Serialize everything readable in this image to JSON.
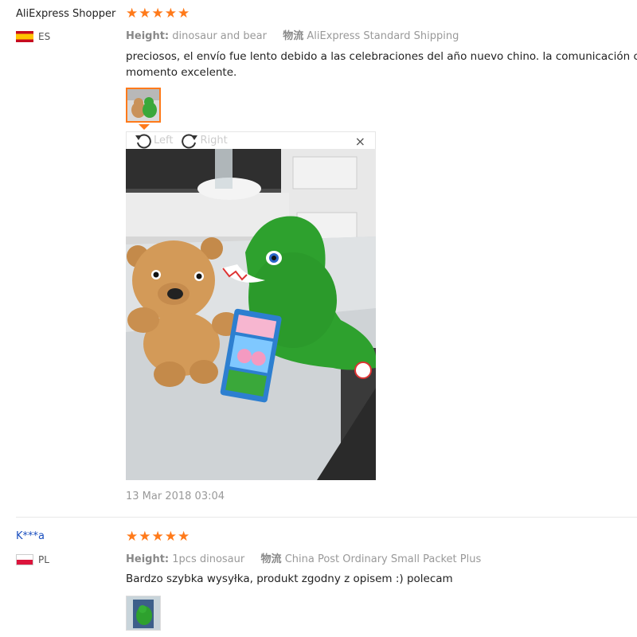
{
  "reviews": [
    {
      "user": "AliExpress Shopper",
      "country": "ES",
      "rating": 5,
      "attr_label": "Height:",
      "attr_value": "dinosaur and bear",
      "shipping_label": "物流",
      "shipping_value": "AliExpress Standard Shipping",
      "text_line1": "preciosos, el envío fue lento debido a las celebraciones del año nuevo chino. la comunicación con",
      "text_line2": "momento excelente.",
      "viewer": {
        "rotate_left": "Left",
        "rotate_right": "Right",
        "close": "×"
      },
      "date": "13 Mar 2018 03:04"
    },
    {
      "user": "K***a",
      "country": "PL",
      "rating": 5,
      "attr_label": "Height:",
      "attr_value": "1pcs dinosaur",
      "shipping_label": "物流",
      "shipping_value": "China Post Ordinary Small Packet Plus",
      "text_line1": "Bardzo szybka wysyłka, produkt zgodny z opisem :) polecam"
    }
  ],
  "colors": {
    "star": "#ff7a1a",
    "link": "#1a4fbf",
    "accent": "#ff7a1a"
  }
}
